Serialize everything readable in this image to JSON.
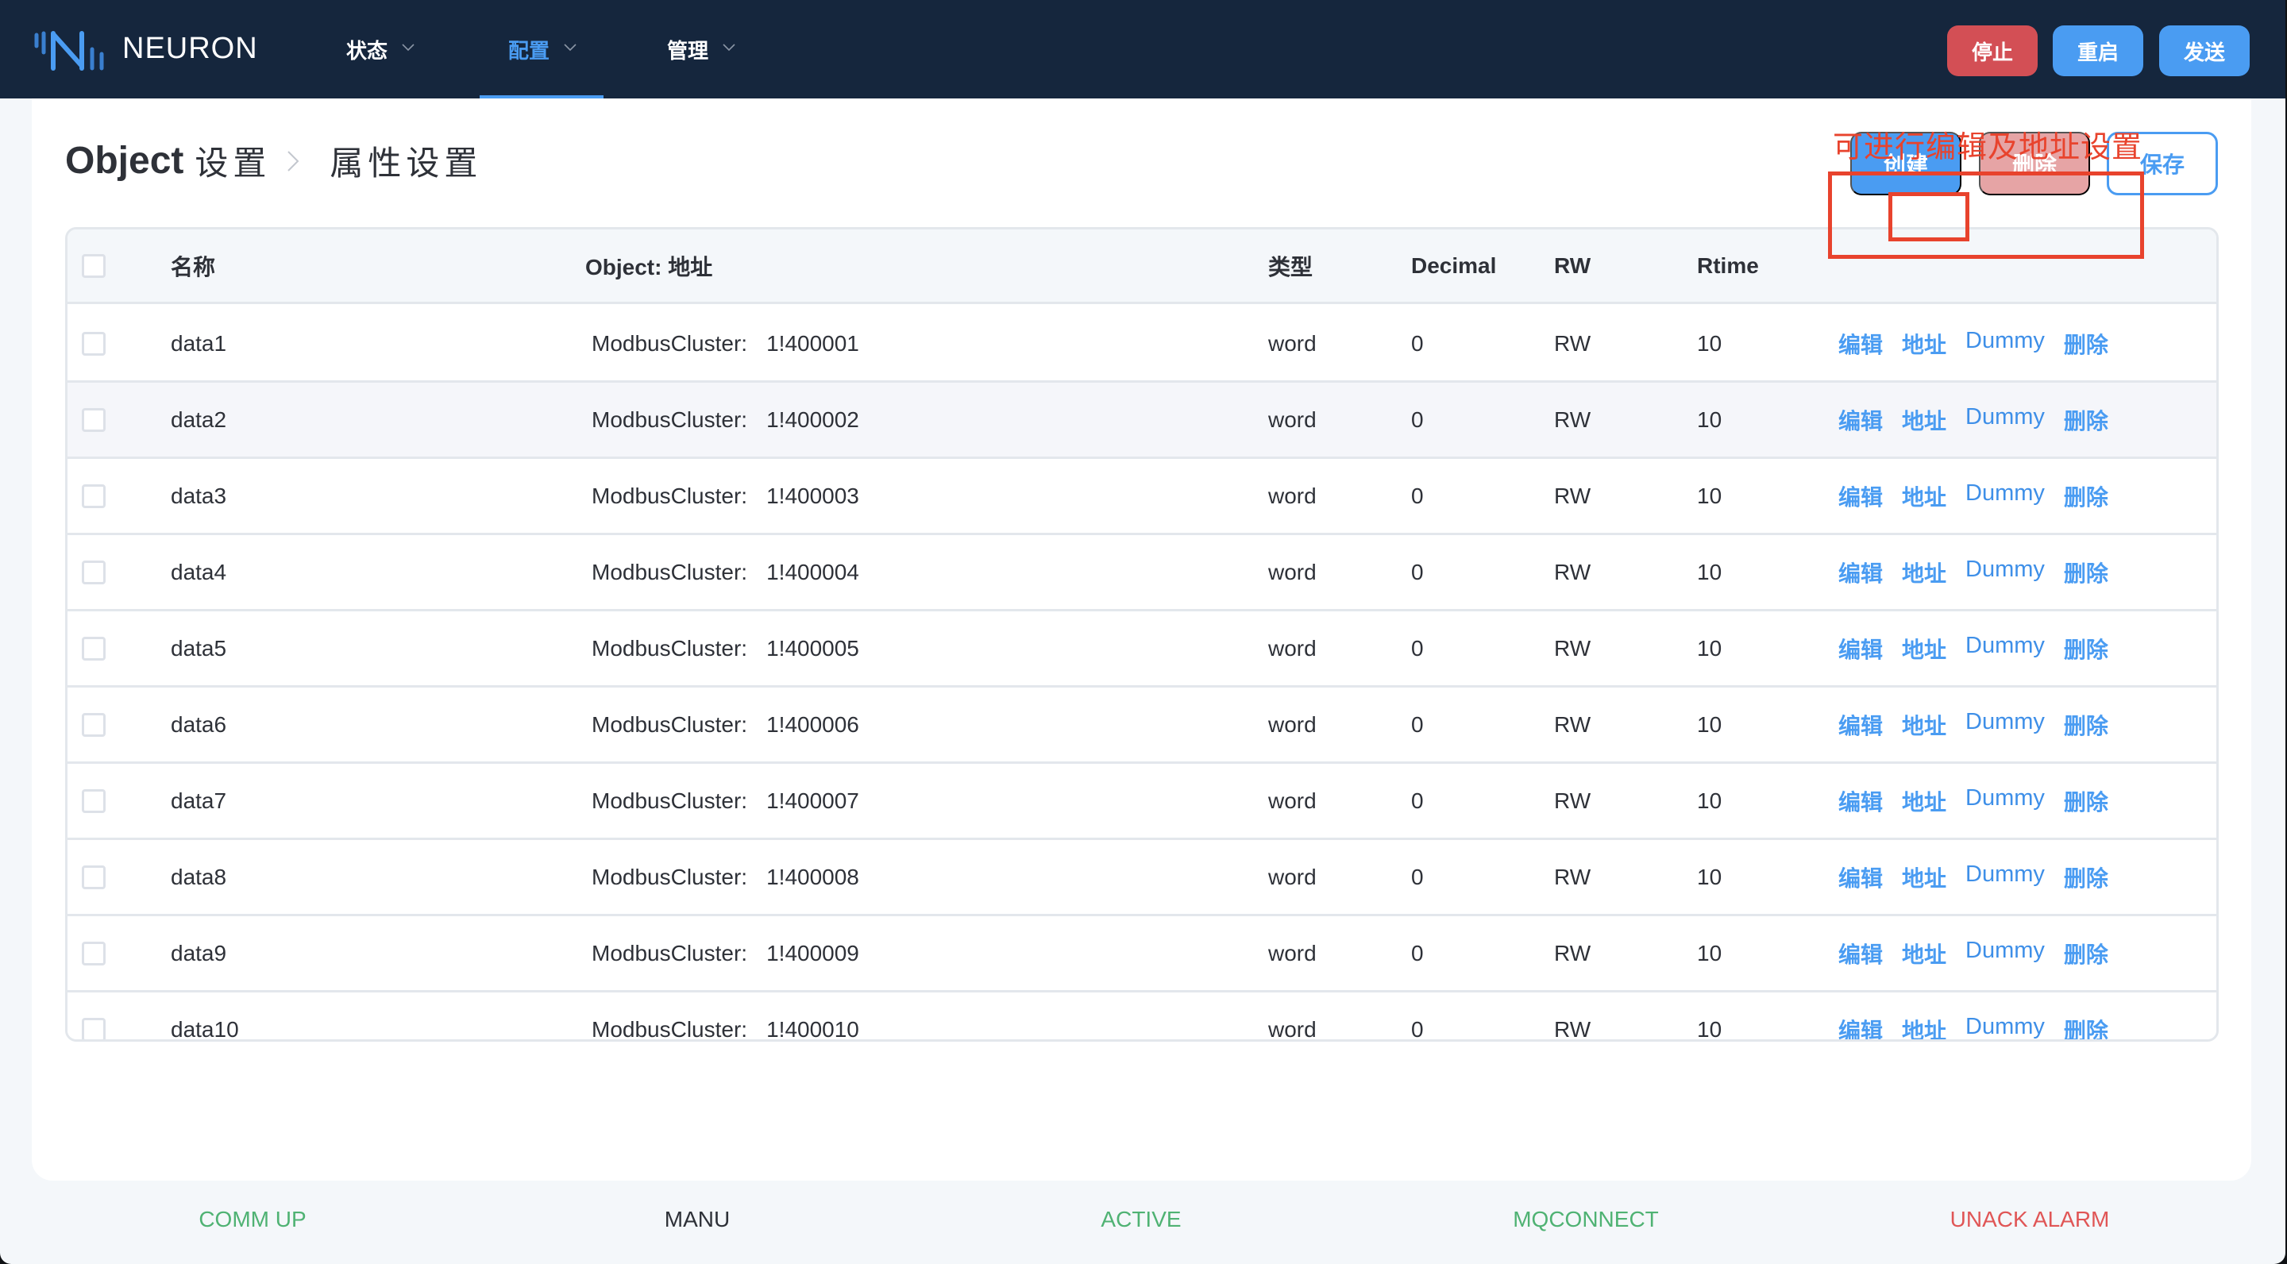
{
  "app": {
    "brand": "NEURON",
    "icon": "neuron-logo-icon"
  },
  "nav": {
    "items": [
      {
        "label": "状态",
        "active": false
      },
      {
        "label": "配置",
        "active": true
      },
      {
        "label": "管理",
        "active": false
      }
    ]
  },
  "header_buttons": {
    "stop": "停止",
    "restart": "重启",
    "send": "发送"
  },
  "page": {
    "title_object": "Object",
    "title_parent": "设置",
    "title_current": "属性设置"
  },
  "actions": {
    "create": "创建",
    "delete": "删除",
    "save": "保存"
  },
  "table": {
    "columns": {
      "name": "名称",
      "address": "Object: 地址",
      "type": "类型",
      "decimal": "Decimal",
      "rw": "RW",
      "rtime": "Rtime"
    },
    "ops": {
      "edit": "编辑",
      "address": "地址",
      "dummy": "Dummy",
      "delete": "删除"
    },
    "rows": [
      {
        "name": "data1",
        "addr_prefix": "ModbusCluster:",
        "addr": "1!400001",
        "type": "word",
        "decimal": "0",
        "rw": "RW",
        "rtime": "10"
      },
      {
        "name": "data2",
        "addr_prefix": "ModbusCluster:",
        "addr": "1!400002",
        "type": "word",
        "decimal": "0",
        "rw": "RW",
        "rtime": "10"
      },
      {
        "name": "data3",
        "addr_prefix": "ModbusCluster:",
        "addr": "1!400003",
        "type": "word",
        "decimal": "0",
        "rw": "RW",
        "rtime": "10"
      },
      {
        "name": "data4",
        "addr_prefix": "ModbusCluster:",
        "addr": "1!400004",
        "type": "word",
        "decimal": "0",
        "rw": "RW",
        "rtime": "10"
      },
      {
        "name": "data5",
        "addr_prefix": "ModbusCluster:",
        "addr": "1!400005",
        "type": "word",
        "decimal": "0",
        "rw": "RW",
        "rtime": "10"
      },
      {
        "name": "data6",
        "addr_prefix": "ModbusCluster:",
        "addr": "1!400006",
        "type": "word",
        "decimal": "0",
        "rw": "RW",
        "rtime": "10"
      },
      {
        "name": "data7",
        "addr_prefix": "ModbusCluster:",
        "addr": "1!400007",
        "type": "word",
        "decimal": "0",
        "rw": "RW",
        "rtime": "10"
      },
      {
        "name": "data8",
        "addr_prefix": "ModbusCluster:",
        "addr": "1!400008",
        "type": "word",
        "decimal": "0",
        "rw": "RW",
        "rtime": "10"
      },
      {
        "name": "data9",
        "addr_prefix": "ModbusCluster:",
        "addr": "1!400009",
        "type": "word",
        "decimal": "0",
        "rw": "RW",
        "rtime": "10"
      },
      {
        "name": "data10",
        "addr_prefix": "ModbusCluster:",
        "addr": "1!400010",
        "type": "word",
        "decimal": "0",
        "rw": "RW",
        "rtime": "10"
      }
    ]
  },
  "annotation": {
    "text": "可进行编辑及地址设置",
    "color": "#e8432d"
  },
  "status_bar": [
    {
      "label": "COMM UP",
      "color": "#4fb273"
    },
    {
      "label": "MANU",
      "color": "#2e3138"
    },
    {
      "label": "ACTIVE",
      "color": "#4fb273"
    },
    {
      "label": "MQCONNECT",
      "color": "#4fb273"
    },
    {
      "label": "UNACK ALARM",
      "color": "#e05656"
    }
  ],
  "colors": {
    "header_bg": "#15263d",
    "accent": "#4a9cf2",
    "danger": "#d34f55",
    "danger_disabled": "#e6a4a5"
  }
}
